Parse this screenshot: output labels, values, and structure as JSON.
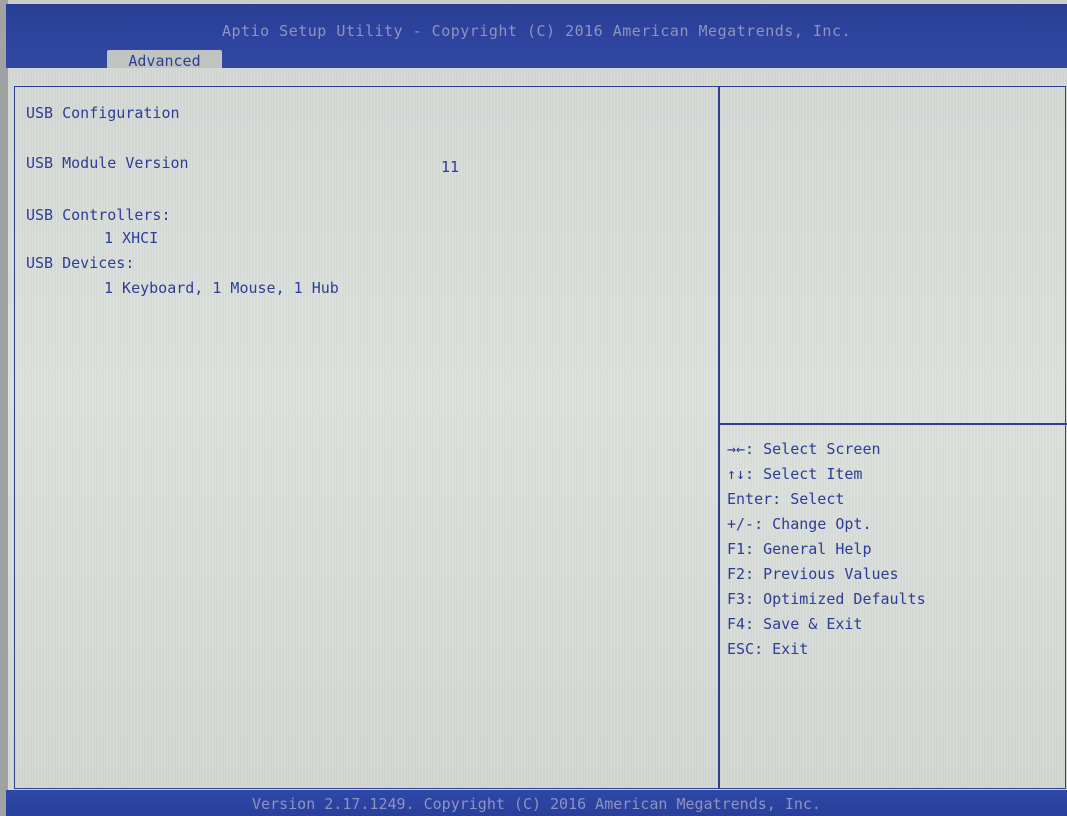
{
  "header": {
    "title": "Aptio Setup Utility - Copyright (C) 2016 American Megatrends, Inc.",
    "active_tab": "Advanced"
  },
  "main": {
    "heading": "USB Configuration",
    "module_version_label": "USB Module Version",
    "module_version_value": "11",
    "controllers_label": "USB Controllers:",
    "controllers_value": "1 XHCI",
    "devices_label": "USB Devices:",
    "devices_value": "1 Keyboard, 1 Mouse, 1 Hub"
  },
  "help": {
    "items": [
      "→←: Select Screen",
      "↑↓: Select Item",
      "Enter: Select",
      "+/-: Change Opt.",
      "F1: General Help",
      "F2: Previous Values",
      "F3: Optimized Defaults",
      "F4: Save & Exit",
      "ESC: Exit"
    ]
  },
  "footer": {
    "text": "Version 2.17.1249. Copyright (C) 2016 American Megatrends, Inc."
  }
}
